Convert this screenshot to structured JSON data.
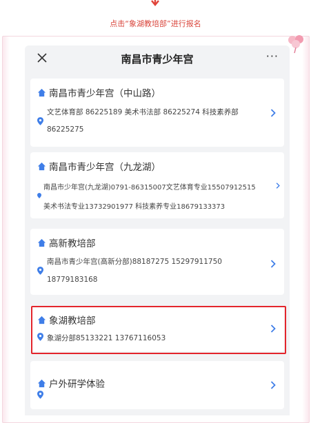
{
  "instruction": "点击“象湖教培部”进行报名",
  "nav": {
    "title": "南昌市青少年宫",
    "more": "···"
  },
  "cards": [
    {
      "title": "南昌市青少年宫（中山路）",
      "line1": "文艺体育部 86225189 美术书法部 86225274 科技素养部",
      "line2": "86225275"
    },
    {
      "title": "南昌市青少年宫（九龙湖）",
      "line1": "南昌市少年宫(九龙湖)0791-86315007文艺体育专业15507912515",
      "line2": "美术书法专业13732901977 科技素养专业18679133373"
    },
    {
      "title": "高新教培部",
      "line1": "南昌市青少年宫(高新分部)88187275 15297911750",
      "line2": "18779183168"
    },
    {
      "title": "象湖教培部",
      "line1": "象湖分部85133221 13767116053",
      "line2": ""
    },
    {
      "title": "户外研学体验",
      "line1": "",
      "line2": ""
    }
  ],
  "colors": {
    "accent_red": "#e3242b",
    "house_icon": "#3f7ee8",
    "pin_icon": "#3f7ee8"
  }
}
